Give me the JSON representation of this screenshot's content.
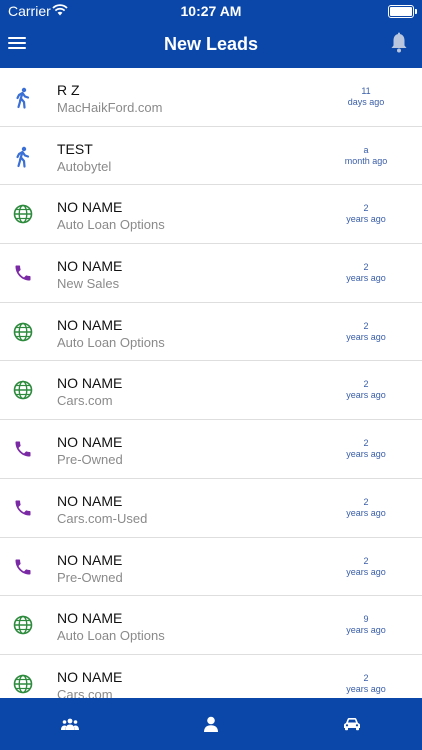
{
  "status_bar": {
    "carrier": "Carrier",
    "time": "10:27 AM"
  },
  "header": {
    "title": "New Leads",
    "menu_icon": "menu-icon",
    "bell_icon": "bell-icon"
  },
  "icons": {
    "walk": "walk-icon",
    "globe": "globe-icon",
    "phone": "phone-icon"
  },
  "colors": {
    "brand": "#0b47a8",
    "walk": "#3a6fd6",
    "globe": "#2e8b3e",
    "phone": "#7b2aa6"
  },
  "leads": [
    {
      "name": "R Z",
      "source": "MacHaikFord.com",
      "time_line1": "11",
      "time_line2": "days ago",
      "icon": "walk"
    },
    {
      "name": "TEST",
      "source": "Autobytel",
      "time_line1": "a",
      "time_line2": "month ago",
      "icon": "walk"
    },
    {
      "name": "NO NAME",
      "source": "Auto Loan Options",
      "time_line1": "2",
      "time_line2": "years ago",
      "icon": "globe"
    },
    {
      "name": "NO NAME",
      "source": "New Sales",
      "time_line1": "2",
      "time_line2": "years ago",
      "icon": "phone"
    },
    {
      "name": "NO NAME",
      "source": "Auto Loan Options",
      "time_line1": "2",
      "time_line2": "years ago",
      "icon": "globe"
    },
    {
      "name": "NO NAME",
      "source": "Cars.com",
      "time_line1": "2",
      "time_line2": "years ago",
      "icon": "globe"
    },
    {
      "name": "NO NAME",
      "source": "Pre-Owned",
      "time_line1": "2",
      "time_line2": "years ago",
      "icon": "phone"
    },
    {
      "name": "NO NAME",
      "source": "Cars.com-Used",
      "time_line1": "2",
      "time_line2": "years ago",
      "icon": "phone"
    },
    {
      "name": "NO NAME",
      "source": "Pre-Owned",
      "time_line1": "2",
      "time_line2": "years ago",
      "icon": "phone"
    },
    {
      "name": "NO NAME",
      "source": "Auto Loan Options",
      "time_line1": "9",
      "time_line2": "years ago",
      "icon": "globe"
    },
    {
      "name": "NO NAME",
      "source": "Cars.com",
      "time_line1": "2",
      "time_line2": "years ago",
      "icon": "globe"
    }
  ],
  "tabs": [
    {
      "icon": "group-icon"
    },
    {
      "icon": "person-icon"
    },
    {
      "icon": "car-icon"
    }
  ]
}
